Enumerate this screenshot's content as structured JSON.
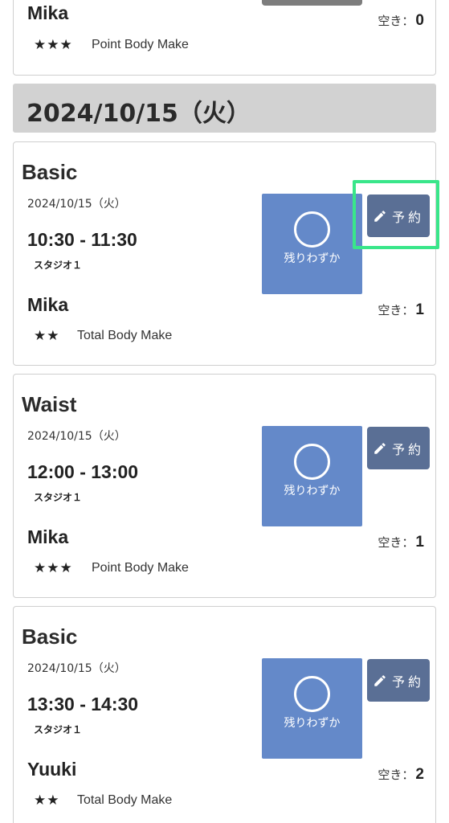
{
  "top_card": {
    "instructor": "Mika",
    "stars": "★★★",
    "program": "Point Body Make",
    "vacancy_label": "空き：",
    "vacancy_count": "0"
  },
  "date_header": "2024/10/15（火）",
  "lessons": [
    {
      "class_name": "Basic",
      "date": "2024/10/15（火）",
      "time": "10:30 - 11:30",
      "studio": "スタジオ１",
      "instructor": "Mika",
      "stars": "★★",
      "program": "Total Body Make",
      "status": "残りわずか",
      "reserve_label": "予約",
      "vacancy_label": "空き：",
      "vacancy_count": "1"
    },
    {
      "class_name": "Waist",
      "date": "2024/10/15（火）",
      "time": "12:00 - 13:00",
      "studio": "スタジオ１",
      "instructor": "Mika",
      "stars": "★★★",
      "program": "Point Body Make",
      "status": "残りわずか",
      "reserve_label": "予約",
      "vacancy_label": "空き：",
      "vacancy_count": "1"
    },
    {
      "class_name": "Basic",
      "date": "2024/10/15（火）",
      "time": "13:30 - 14:30",
      "studio": "スタジオ１",
      "instructor": "Yuuki",
      "stars": "★★",
      "program": "Total Body Make",
      "status": "残りわずか",
      "reserve_label": "予約",
      "vacancy_label": "空き：",
      "vacancy_count": "2"
    }
  ],
  "colors": {
    "status_box": "#6489c9",
    "reserve_button": "#5a6f95",
    "highlight": "#39e68a",
    "date_header_bg": "#d2d2d2"
  },
  "icons": {
    "reserve": "pencil-icon",
    "status": "circle-icon"
  }
}
